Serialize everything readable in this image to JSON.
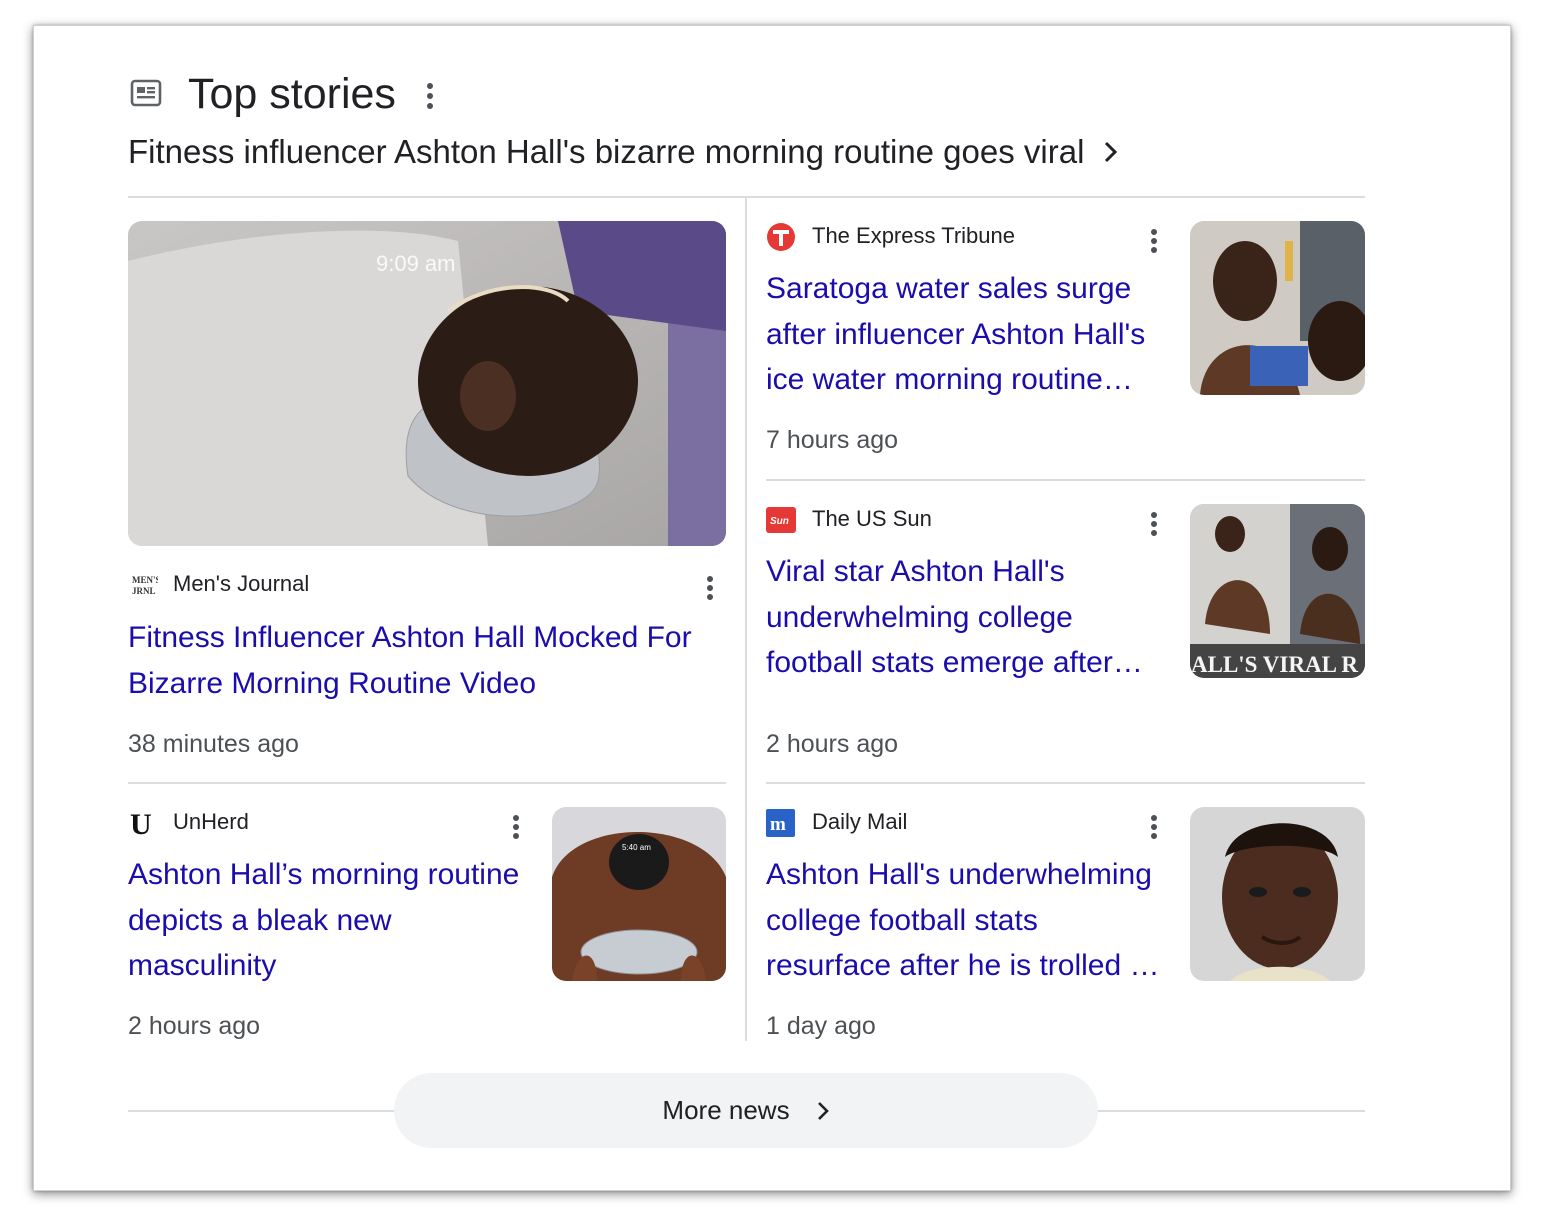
{
  "header": {
    "icon": "newspaper-icon",
    "title": "Top stories",
    "menu_icon": "more-vert-icon"
  },
  "topic": {
    "label": "Fitness influencer Ashton Hall's bizarre morning routine goes viral",
    "icon": "chevron-right-icon"
  },
  "stories": [
    {
      "source": "Men's Journal",
      "source_logo": "mens-journal-logo",
      "headline": "Fitness Influencer Ashton Hall Mocked For Bizarre Morning Routine Video",
      "time": "38 minutes ago",
      "image_overlay_text": "9:09 am"
    },
    {
      "source": "The Express Tribune",
      "source_logo": "express-tribune-logo",
      "headline": "Saratoga water sales surge after influencer Ashton Hall's ice water morning routine…",
      "time": "7 hours ago"
    },
    {
      "source": "The US Sun",
      "source_logo": "us-sun-logo",
      "headline": "Viral star Ashton Hall's underwhelming college football stats emerge after…",
      "time": "2 hours ago",
      "image_overlay_text": "ALL'S VIRAL R"
    },
    {
      "source": "UnHerd",
      "source_logo": "unherd-logo",
      "headline": "Ashton Hall’s morning routine depicts a bleak new masculinity",
      "time": "2 hours ago",
      "image_overlay_text": "5:40 am"
    },
    {
      "source": "Daily Mail",
      "source_logo": "daily-mail-logo",
      "headline": "Ashton Hall's underwhelming college football stats resurface after he is trolled …",
      "time": "1 day ago"
    }
  ],
  "more_news": {
    "label": "More news",
    "icon": "chevron-right-icon"
  },
  "colors": {
    "link": "#1a0dab",
    "text": "#202124",
    "muted": "#4d5156",
    "divider": "#dadce0",
    "button_bg": "#f1f3f4"
  }
}
